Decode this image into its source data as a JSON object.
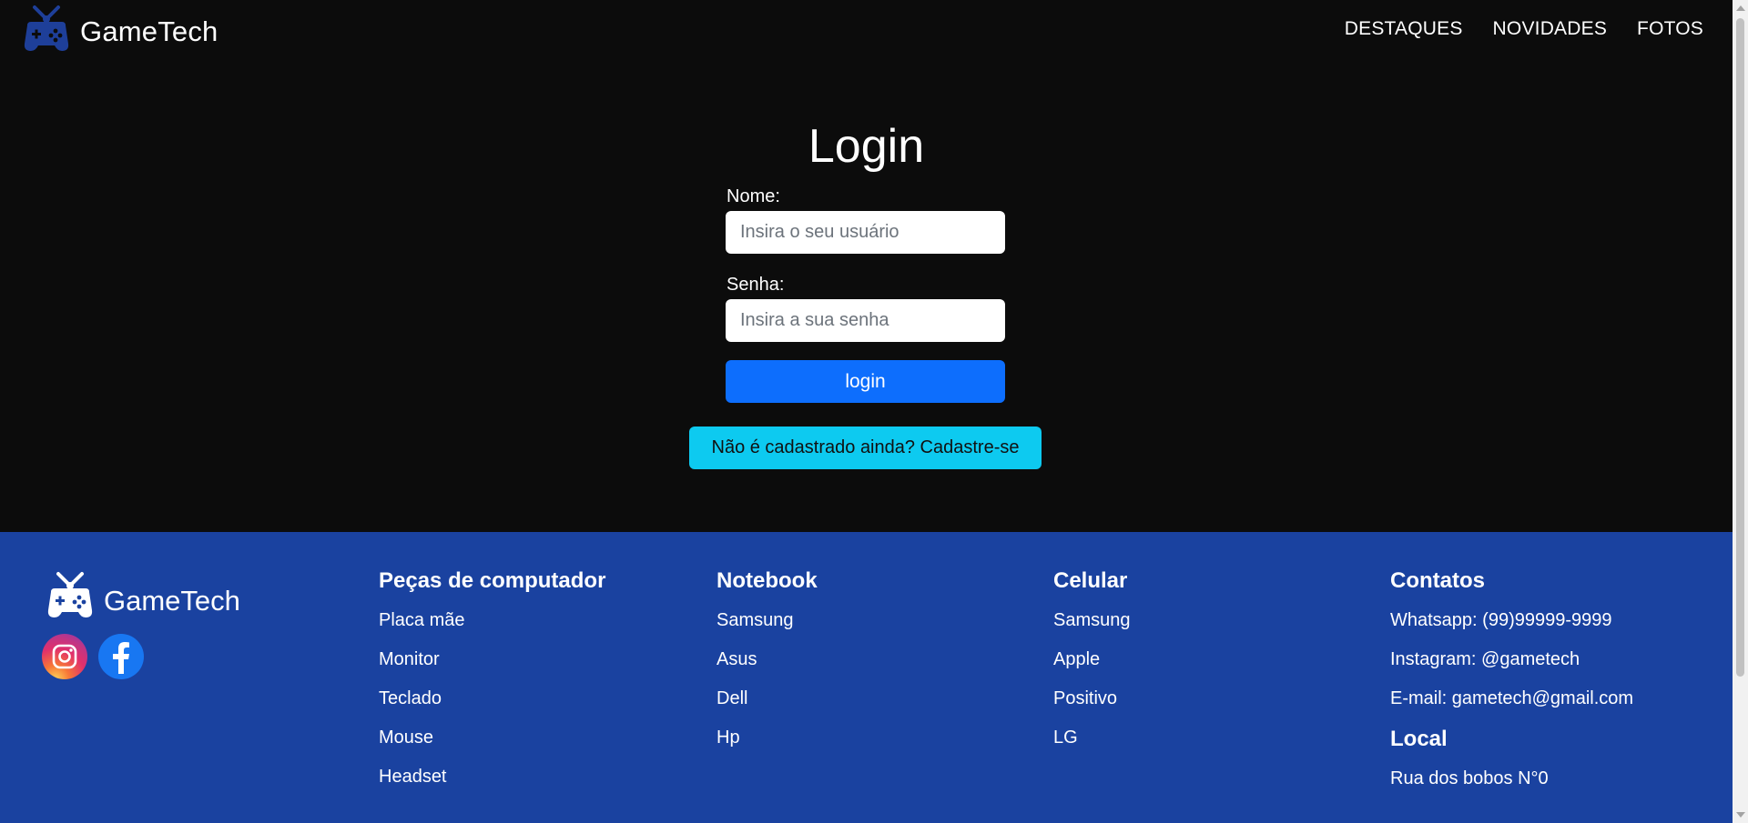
{
  "brand": {
    "name": "GameTech"
  },
  "nav": {
    "items": [
      "DESTAQUES",
      "NOVIDADES",
      "FOTOS"
    ]
  },
  "login": {
    "title": "Login",
    "name_label": "Nome:",
    "name_placeholder": "Insira o seu usuário",
    "password_label": "Senha:",
    "password_placeholder": "Insira a sua senha",
    "submit_label": "login",
    "signup_label": "Não é cadastrado ainda? Cadastre-se"
  },
  "colors": {
    "background": "#0c0c0c",
    "footer": "#1a42a0",
    "primary_button": "#0d6efd",
    "signup_button": "#0dcaf0",
    "logo_blue": "#1e3f99"
  },
  "footer": {
    "brand_name": "GameTech",
    "socials": [
      "instagram-icon",
      "facebook-icon"
    ],
    "columns": [
      {
        "title": "Peças de computador",
        "items": [
          "Placa mãe",
          "Monitor",
          "Teclado",
          "Mouse",
          "Headset"
        ]
      },
      {
        "title": "Notebook",
        "items": [
          "Samsung",
          "Asus",
          "Dell",
          "Hp"
        ]
      },
      {
        "title": "Celular",
        "items": [
          "Samsung",
          "Apple",
          "Positivo",
          "LG"
        ]
      }
    ],
    "contacts": {
      "title": "Contatos",
      "items": [
        "Whatsapp: (99)99999-9999",
        "Instagram: @gametech",
        "E-mail: gametech@gmail.com"
      ]
    },
    "local": {
      "title": "Local",
      "address": "Rua dos bobos N°0"
    }
  }
}
